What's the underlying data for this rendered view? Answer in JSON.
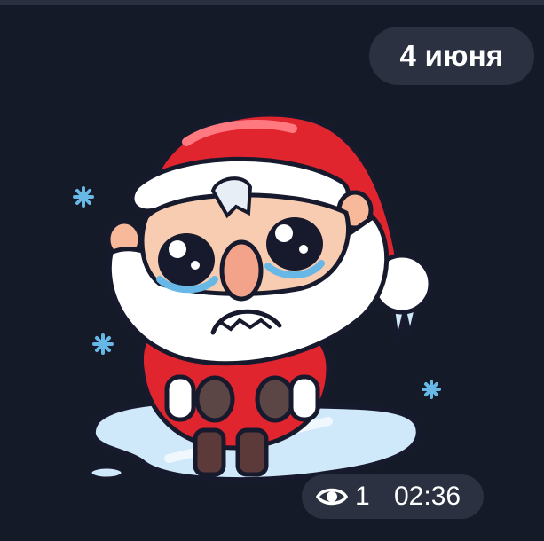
{
  "date_badge": {
    "label": "4 июня"
  },
  "message": {
    "sticker": {
      "icon": "crying-santa-sticker-icon"
    },
    "meta": {
      "views_icon": "eye-icon",
      "views": "1",
      "time": "02:36"
    }
  },
  "colors": {
    "background": "#151a29",
    "pill": "#2b3140",
    "text": "#ffffff"
  }
}
